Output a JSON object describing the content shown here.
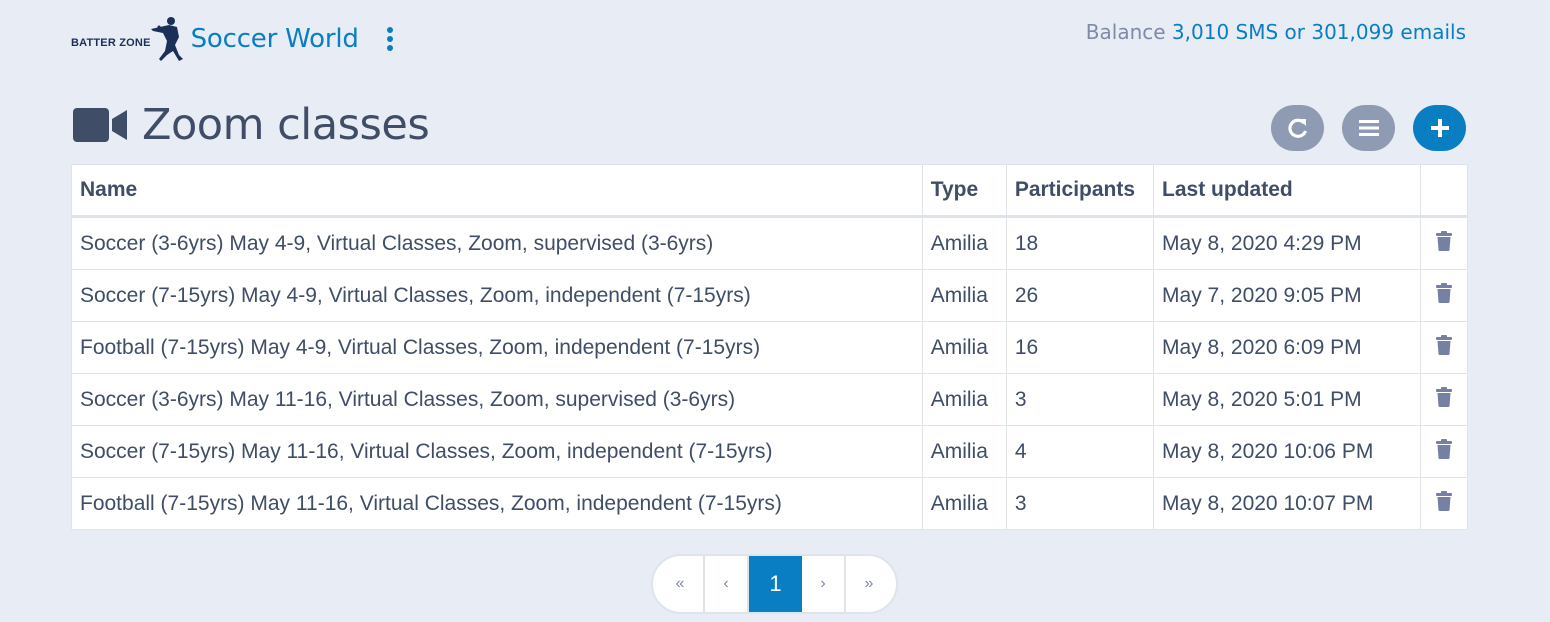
{
  "brand": {
    "logo_text": "BATTER ZONE",
    "app_name": "Soccer World"
  },
  "balance": {
    "label": "Balance",
    "sms": "3,010 SMS",
    "or": "or",
    "emails": "301,099 emails"
  },
  "page": {
    "title": "Zoom classes",
    "icon": "video-camera-icon"
  },
  "actions": [
    {
      "name": "refresh",
      "icon": "refresh-icon"
    },
    {
      "name": "list",
      "icon": "list-icon"
    },
    {
      "name": "add",
      "icon": "plus-icon"
    }
  ],
  "colors": {
    "accent": "#0a7ec2",
    "muted_button": "#8f9bb3",
    "text": "#3f4d67",
    "background": "#e8ecf4"
  },
  "table": {
    "columns": [
      "Name",
      "Type",
      "Participants",
      "Last updated",
      ""
    ],
    "rows": [
      {
        "name": "Soccer (3-6yrs) May 4-9, Virtual Classes, Zoom, supervised (3-6yrs)",
        "type": "Amilia",
        "participants": "18",
        "updated": "May 8, 2020 4:29 PM"
      },
      {
        "name": "Soccer (7-15yrs) May 4-9, Virtual Classes, Zoom, independent (7-15yrs)",
        "type": "Amilia",
        "participants": "26",
        "updated": "May 7, 2020 9:05 PM"
      },
      {
        "name": "Football (7-15yrs) May 4-9, Virtual Classes, Zoom, independent (7-15yrs)",
        "type": "Amilia",
        "participants": "16",
        "updated": "May 8, 2020 6:09 PM"
      },
      {
        "name": "Soccer (3-6yrs) May 11-16, Virtual Classes, Zoom, supervised (3-6yrs)",
        "type": "Amilia",
        "participants": "3",
        "updated": "May 8, 2020 5:01 PM"
      },
      {
        "name": "Soccer (7-15yrs) May 11-16, Virtual Classes, Zoom, independent (7-15yrs)",
        "type": "Amilia",
        "participants": "4",
        "updated": "May 8, 2020 10:06 PM"
      },
      {
        "name": "Football (7-15yrs) May 11-16, Virtual Classes, Zoom, independent (7-15yrs)",
        "type": "Amilia",
        "participants": "3",
        "updated": "May 8, 2020 10:07 PM"
      }
    ]
  },
  "pagination": {
    "first": "«",
    "prev": "‹",
    "current": "1",
    "next": "›",
    "last": "»"
  }
}
